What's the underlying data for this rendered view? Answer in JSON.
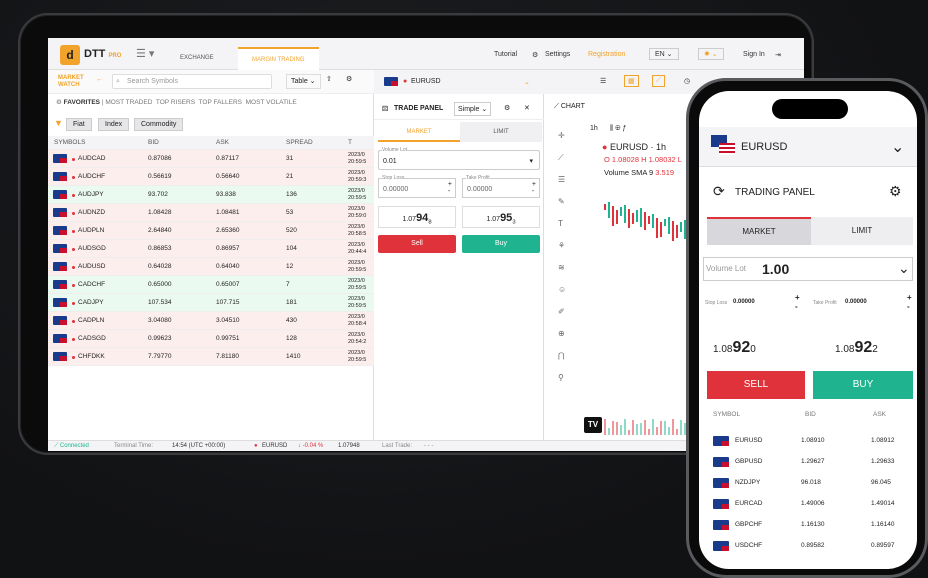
{
  "header": {
    "logo_text": "DTT",
    "logo_sub": "PRO",
    "tab_exchange": "EXCHANGE",
    "tab_margin": "MARGIN TRADING",
    "tutorial": "Tutorial",
    "settings": "Settings",
    "registration": "Registration",
    "lang": "EN",
    "signin": "Sign In"
  },
  "watch": {
    "title": "MARKET WATCH",
    "search_placeholder": "Search Symbols",
    "view": "Table",
    "filters": [
      "FAVORITES",
      "MOST TRADED",
      "TOP RISERS",
      "TOP FALLERS",
      "MOST VOLATILE"
    ],
    "chips": [
      "Fiat",
      "Index",
      "Commodity"
    ],
    "columns": [
      "SYMBOLS",
      "BID",
      "ASK",
      "SPREAD",
      "T"
    ],
    "rows": [
      {
        "sym": "AUDCAD",
        "bid": "0.87086",
        "ask": "0.87117",
        "spread": "31",
        "t": "2023/0 20:59:5"
      },
      {
        "sym": "AUDCHF",
        "bid": "0.56619",
        "ask": "0.56640",
        "spread": "21",
        "t": "2023/0 20:59:3"
      },
      {
        "sym": "AUDJPY",
        "bid": "93.702",
        "ask": "93.838",
        "spread": "136",
        "t": "2023/0 20:59:5"
      },
      {
        "sym": "AUDNZD",
        "bid": "1.08428",
        "ask": "1.08481",
        "spread": "53",
        "t": "2023/0 20:59:0"
      },
      {
        "sym": "AUDPLN",
        "bid": "2.64840",
        "ask": "2.65360",
        "spread": "520",
        "t": "2023/0 20:58:5"
      },
      {
        "sym": "AUDSGD",
        "bid": "0.86853",
        "ask": "0.86957",
        "spread": "104",
        "t": "2023/0 20:44:4"
      },
      {
        "sym": "AUDUSD",
        "bid": "0.64028",
        "ask": "0.64040",
        "spread": "12",
        "t": "2023/0 20:59:5"
      },
      {
        "sym": "CADCHF",
        "bid": "0.65000",
        "ask": "0.65007",
        "spread": "7",
        "t": "2023/0 20:59:5"
      },
      {
        "sym": "CADJPY",
        "bid": "107.534",
        "ask": "107.715",
        "spread": "181",
        "t": "2023/0 20:59:5"
      },
      {
        "sym": "CADPLN",
        "bid": "3.04080",
        "ask": "3.04510",
        "spread": "430",
        "t": "2023/0 20:58:4"
      },
      {
        "sym": "CADSGD",
        "bid": "0.99623",
        "ask": "0.99751",
        "spread": "128",
        "t": "2023/0 20:54:2"
      },
      {
        "sym": "CHFDKK",
        "bid": "7.79770",
        "ask": "7.81180",
        "spread": "1410",
        "t": "2023/0 20:59:5"
      }
    ]
  },
  "trade": {
    "symbol": "EURUSD",
    "panel": "TRADE PANEL",
    "mode": "Simple",
    "market": "MARKET",
    "limit": "LIMIT",
    "volume_label": "Volume Lot",
    "volume": "0.01",
    "sl_label": "Stop Loss",
    "sl": "0.00000",
    "tp_label": "Take Profit",
    "tp": "0.00000",
    "sell_pre": "1.07",
    "sell_big": "94",
    "sell_post": "8",
    "buy_pre": "1.07",
    "buy_big": "95",
    "buy_post": "3",
    "sell": "Sell",
    "buy": "Buy"
  },
  "chart": {
    "title": "CHART",
    "tf": "1h",
    "symbol": "EURUSD",
    "tf2": "1h",
    "ohlc": "O 1.08028 H 1.08032 L",
    "vol": "Volume SMA 9",
    "vol_val": "3.519"
  },
  "status": {
    "connected": "Connected",
    "terminal": "Terminal Time:",
    "time": "14:54 (UTC +00:00)",
    "sym": "EURUSD",
    "chg": "-0.04 %",
    "price": "1.07948",
    "last": "Last Trade:",
    "last_val": "-  -  -"
  },
  "phone": {
    "symbol": "EURUSD",
    "panel": "TRADING PANEL",
    "market": "MARKET",
    "limit": "LIMIT",
    "vol_label": "Volume Lot",
    "vol": "1.00",
    "sl_label": "Stop Loss",
    "sl": "0.00000",
    "tp_label": "Take Profit",
    "tp": "0.00000",
    "sell_pre": "1.08",
    "sell_big": "92",
    "sell_post": "0",
    "buy_pre": "1.08",
    "buy_big": "92",
    "buy_post": "2",
    "sell": "SELL",
    "buy": "BUY",
    "cols": [
      "SYMBOL",
      "BID",
      "ASK"
    ],
    "rows": [
      {
        "sym": "EURUSD",
        "bid": "1.08910",
        "ask": "1.08912"
      },
      {
        "sym": "GBPUSD",
        "bid": "1.29627",
        "ask": "1.29633"
      },
      {
        "sym": "NZDJPY",
        "bid": "96.018",
        "ask": "96.045"
      },
      {
        "sym": "EURCAD",
        "bid": "1.49006",
        "ask": "1.49014"
      },
      {
        "sym": "GBPCHF",
        "bid": "1.16130",
        "ask": "1.16140"
      },
      {
        "sym": "USDCHF",
        "bid": "0.89582",
        "ask": "0.89597"
      }
    ]
  }
}
